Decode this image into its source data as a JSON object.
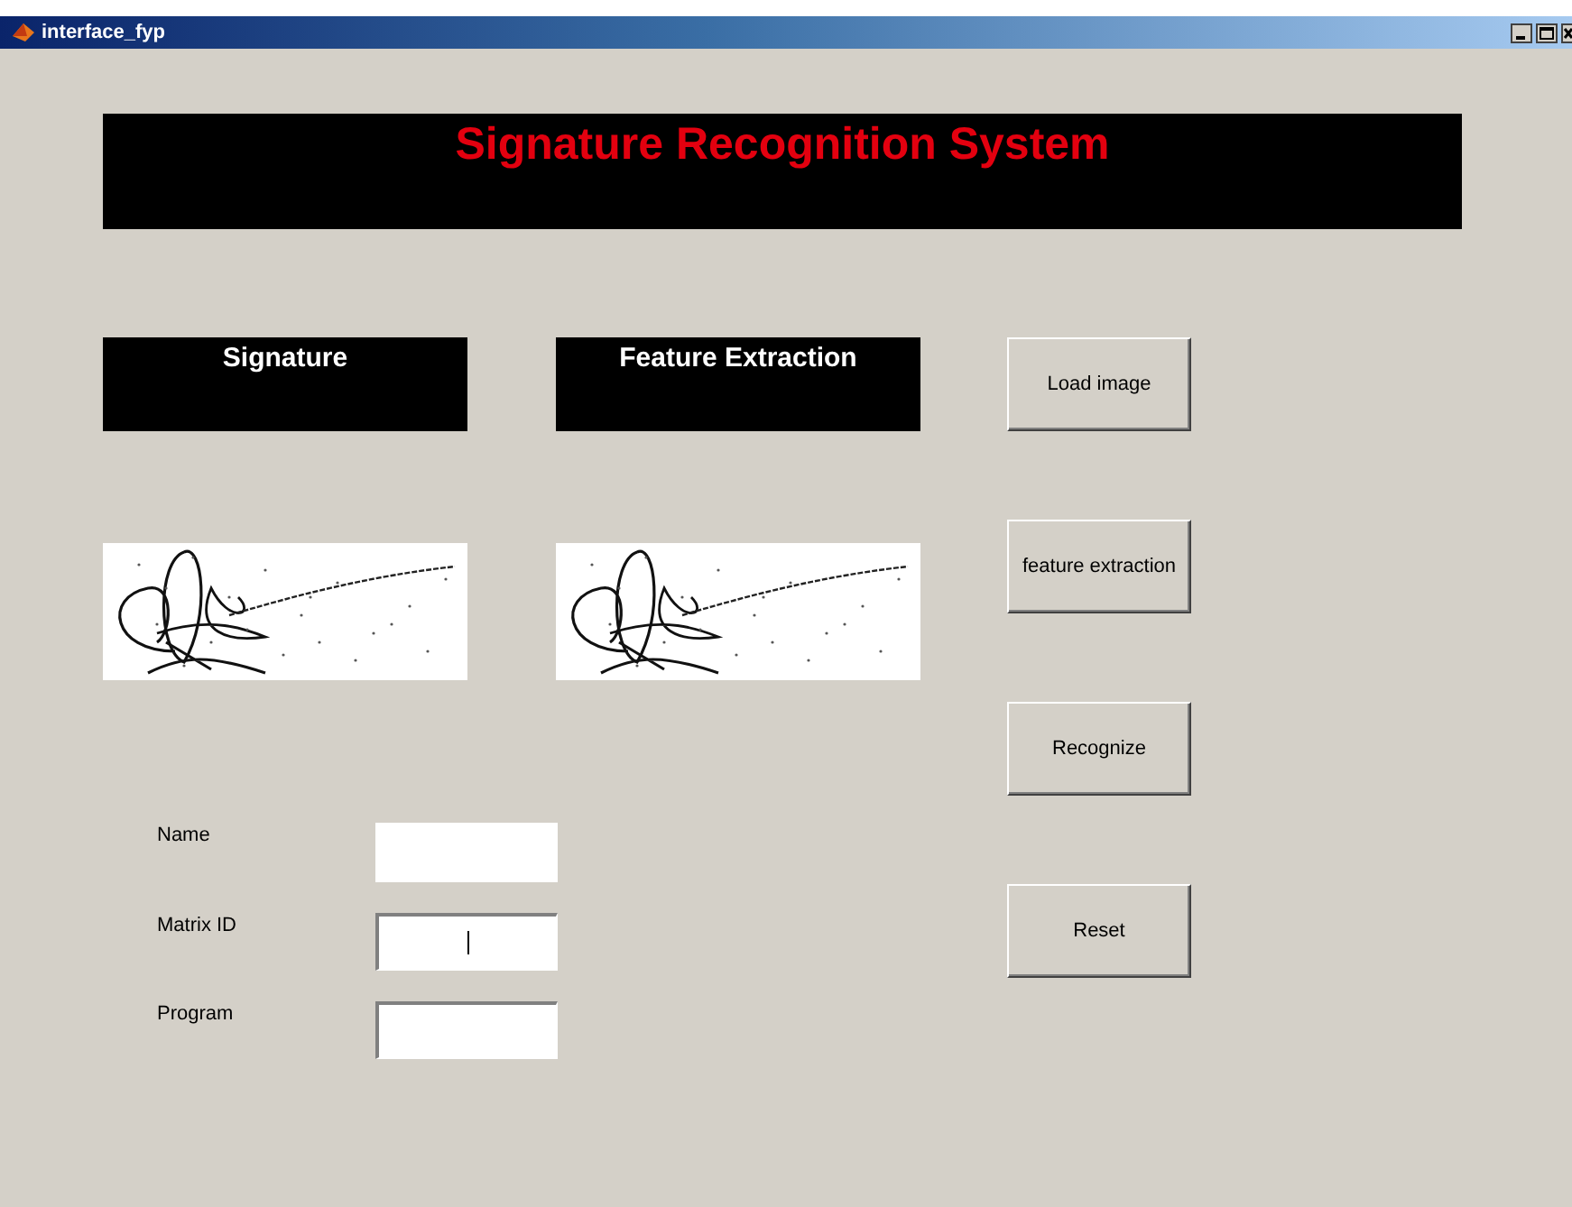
{
  "window": {
    "title": "interface_fyp"
  },
  "banner": {
    "title": "Signature Recognition System"
  },
  "panels": [
    {
      "title": "Signature"
    },
    {
      "title": "Feature Extraction"
    }
  ],
  "buttons": [
    "Load image",
    "feature extraction",
    "Recognize",
    "Reset"
  ],
  "fields": [
    {
      "label": "Name",
      "focused": false,
      "sunken": false
    },
    {
      "label": "Matrix ID",
      "focused": true,
      "sunken": true
    },
    {
      "label": "Program",
      "focused": false,
      "sunken": true
    }
  ]
}
